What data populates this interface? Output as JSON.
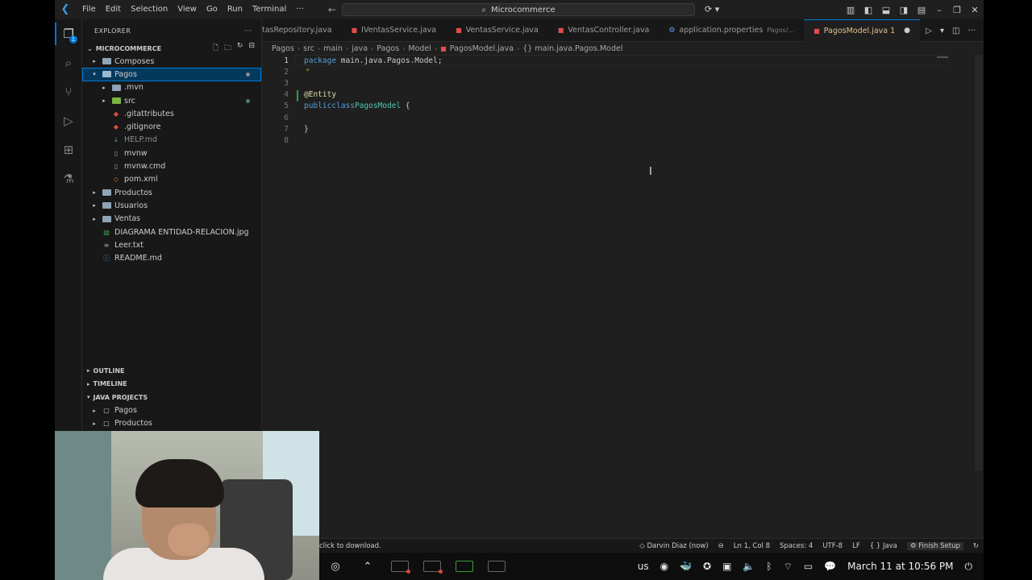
{
  "titlebar": {
    "menu": [
      "File",
      "Edit",
      "Selection",
      "View",
      "Go",
      "Run",
      "Terminal",
      "···"
    ],
    "search_text": "Microcommerce"
  },
  "sidebar": {
    "header": "EXPLORER",
    "header_menu": "···",
    "root": "MICROCOMMERCE",
    "items": [
      {
        "label": "Composes",
        "type": "folder",
        "indent": 1,
        "expanded": false
      },
      {
        "label": "Pagos",
        "type": "folder",
        "indent": 1,
        "expanded": true,
        "selected": true
      },
      {
        "label": ".mvn",
        "type": "folder",
        "indent": 2,
        "expanded": false
      },
      {
        "label": "src",
        "type": "folder",
        "indent": 2,
        "expanded": false
      },
      {
        "label": ".gitattributes",
        "type": "git",
        "indent": 2
      },
      {
        "label": ".gitignore",
        "type": "git",
        "indent": 2
      },
      {
        "label": "HELP.md",
        "type": "md",
        "indent": 2
      },
      {
        "label": "mvnw",
        "type": "file",
        "indent": 2
      },
      {
        "label": "mvnw.cmd",
        "type": "file",
        "indent": 2
      },
      {
        "label": "pom.xml",
        "type": "xml",
        "indent": 2
      },
      {
        "label": "Productos",
        "type": "folder",
        "indent": 1,
        "expanded": false
      },
      {
        "label": "Usuarios",
        "type": "folder",
        "indent": 1,
        "expanded": false
      },
      {
        "label": "Ventas",
        "type": "folder",
        "indent": 1,
        "expanded": false
      },
      {
        "label": "DIAGRAMA ENTIDAD-RELACION.jpg",
        "type": "image",
        "indent": 1
      },
      {
        "label": "Leer.txt",
        "type": "txt",
        "indent": 1
      },
      {
        "label": "README.md",
        "type": "info",
        "indent": 1
      }
    ],
    "outline": "OUTLINE",
    "timeline": "TIMELINE",
    "java_projects": "JAVA PROJECTS",
    "java_items": [
      "Pagos",
      "Productos"
    ]
  },
  "tabs": [
    {
      "label": "tasRepository.java",
      "icon": "java"
    },
    {
      "label": "IVentasService.java",
      "icon": "java"
    },
    {
      "label": "VentasService.java",
      "icon": "java"
    },
    {
      "label": "VentasController.java",
      "icon": "java"
    },
    {
      "label": "application.properties",
      "icon": "gear",
      "path": "Pagos/..."
    },
    {
      "label": "PagosModel.java 1",
      "icon": "java",
      "active": true
    }
  ],
  "breadcrumbs": [
    "Pagos",
    "src",
    "main",
    "java",
    "Pagos",
    "Model",
    "PagosModel.java",
    "{} main.java.Pagos.Model"
  ],
  "code": {
    "line_numbers": [
      "1",
      "2",
      "3",
      "4",
      "5",
      "6",
      "7",
      "8"
    ],
    "line1_kw": "package",
    "line1_rest": " main.java.Pagos.Model;",
    "line4": "@Entity",
    "line5_kw1": "public",
    "line5_kw2": "class",
    "line5_name": "PagosModel",
    "line5_rest": " {",
    "line7": "}"
  },
  "statusbar": {
    "message": "click to download.",
    "author": "Darvin Diaz (now)",
    "position": "Ln 1, Col 8",
    "spaces": "Spaces: 4",
    "encoding": "UTF-8",
    "eol": "LF",
    "language": "{ } Java",
    "finish": "Finish Setup"
  },
  "taskbar": {
    "keyboard": "us",
    "clock": "March 11 at 10:56 PM"
  }
}
